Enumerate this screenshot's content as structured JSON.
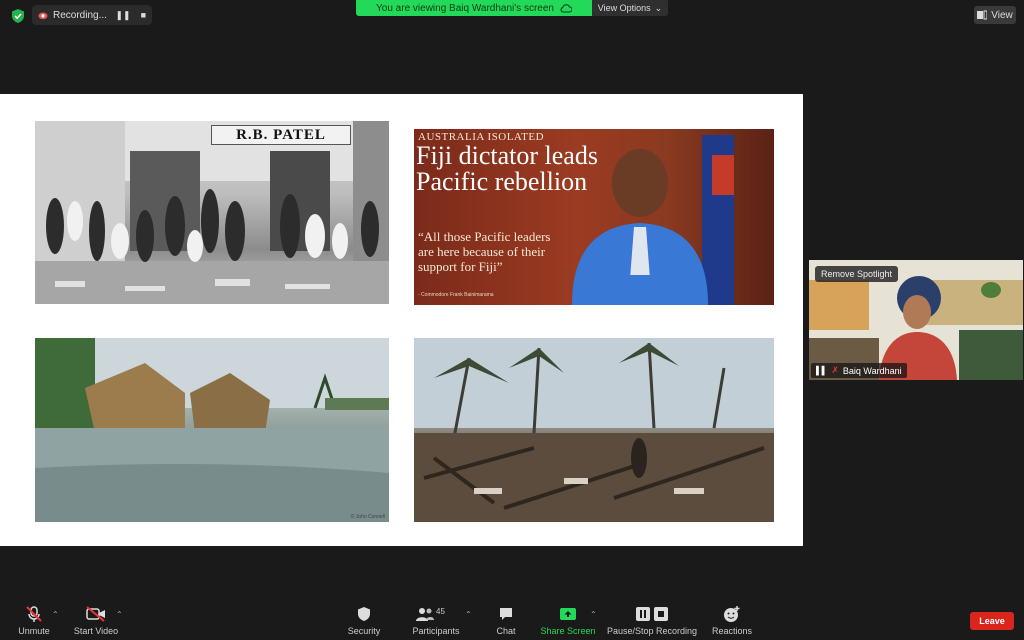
{
  "recording": {
    "label": "Recording...",
    "pause_icon": "pause-icon",
    "stop_icon": "stop-icon"
  },
  "share_banner": {
    "text": "You are viewing Baiq Wardhani's screen",
    "view_options": "View Options"
  },
  "view_button": {
    "label": "View"
  },
  "slide": {
    "photo2": {
      "kicker": "AUSTRALIA ISOLATED",
      "headline": "Fiji dictator leads Pacific rebellion",
      "quote": "“All those Pacific leaders are here because of their support for Fiji”",
      "attribution": "- Commodore Frank Bainimarama"
    },
    "photo1": {
      "sign": "R.B. PATEL"
    },
    "photo3": {
      "credit": "© John Connell"
    }
  },
  "spotlight": {
    "remove_label": "Remove Spotlight",
    "name": "Baiq Wardhani"
  },
  "toolbar": {
    "unmute": "Unmute",
    "start_video": "Start Video",
    "security": "Security",
    "participants": "Participants",
    "participants_count": "45",
    "chat": "Chat",
    "share_screen": "Share Screen",
    "pause_stop": "Pause/Stop Recording",
    "reactions": "Reactions",
    "leave": "Leave"
  },
  "colors": {
    "share_green": "#23d959",
    "leave_red": "#d9251c",
    "background": "#1a1a1a"
  }
}
